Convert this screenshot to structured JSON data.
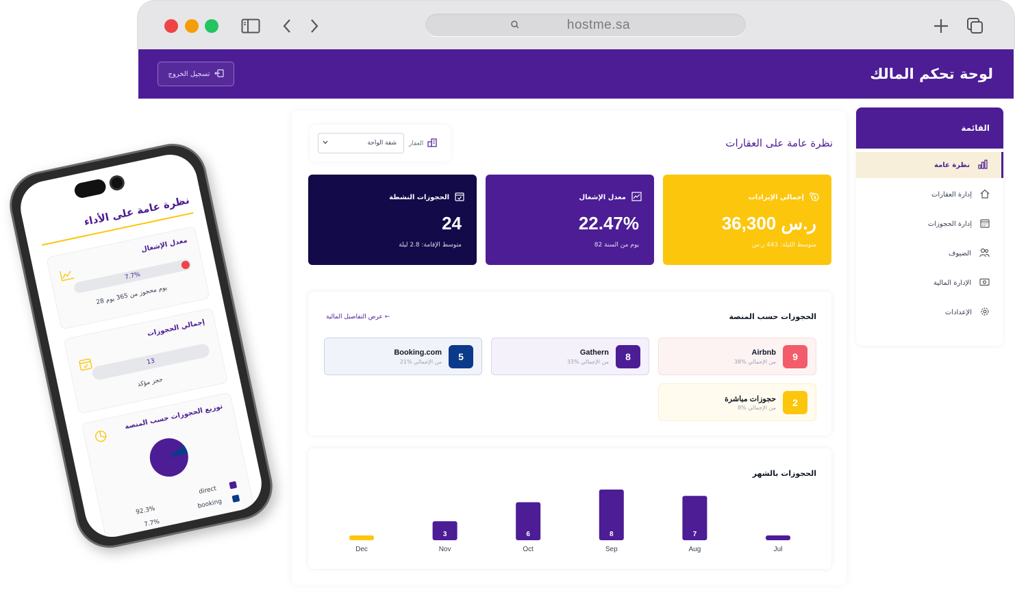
{
  "browser": {
    "url": "hostme.sa"
  },
  "app": {
    "title": "لوحة تحكم المالك",
    "logout_label": "تسجيل الخروج"
  },
  "sidebar": {
    "title": "القائمة",
    "items": [
      {
        "label": "نظرة عامة",
        "icon": "bar-chart-icon",
        "active": true
      },
      {
        "label": "إدارة العقارات",
        "icon": "home-icon"
      },
      {
        "label": "إدارة الحجوزات",
        "icon": "calendar-icon"
      },
      {
        "label": "الضيوف",
        "icon": "users-icon"
      },
      {
        "label": "الإدارة المالية",
        "icon": "cash-icon"
      },
      {
        "label": "الإعدادات",
        "icon": "gear-icon"
      }
    ]
  },
  "overview": {
    "title": "نظرة عامة على العقارات",
    "property_label": "العقار",
    "property_value": "شقة الواحة"
  },
  "stats": {
    "revenue": {
      "label": "إجمالي الإيرادات",
      "value": "36,300 ر.س",
      "sub": "متوسط الليلة: 443 ر.س"
    },
    "occupancy": {
      "label": "معدل الإشغال",
      "value": "22.47%",
      "sub": "82 يوم من السنة"
    },
    "active": {
      "label": "الحجوزات النشطة",
      "value": "24",
      "sub": "متوسط الإقامة: 2.8 ليلة"
    }
  },
  "platforms": {
    "title": "الحجوزات حسب المنصة",
    "link": "عرض التفاصيل المالية ←",
    "items": [
      {
        "name": "Airbnb",
        "count": "9",
        "pct": "38% من الإجمالي"
      },
      {
        "name": "Gathern",
        "count": "8",
        "pct": "33% من الإجمالي"
      },
      {
        "name": "Booking.com",
        "count": "5",
        "pct": "21% من الإجمالي"
      },
      {
        "name": "حجوزات مباشرة",
        "count": "2",
        "pct": "8% من الإجمالي"
      }
    ],
    "colors": {
      "airbnb": "#f25c6b",
      "gathern": "#4c1d95",
      "booking": "#0b3a8a",
      "direct": "#fcc60d"
    }
  },
  "monthly": {
    "title": "الحجوزات بالشهر"
  },
  "chart_data": {
    "type": "bar",
    "categories": [
      "Dec",
      "Nov",
      "Oct",
      "Sep",
      "Aug",
      "Jul"
    ],
    "values": [
      0,
      3,
      6,
      8,
      7,
      0
    ],
    "colors": {
      "bar": "#4c1d95",
      "zero_bar": "#fcc60d"
    }
  },
  "phone": {
    "title": "نظرة عامة على الأداء",
    "occupancy": {
      "title": "معدل الإشغال",
      "value": "7.7%",
      "sub": "28 يوم محجوز من 365 يوم"
    },
    "bookings": {
      "title": "إجمالي الحجوزات",
      "value": "13",
      "sub": "حجز مؤكد"
    },
    "distribution": {
      "title": "توزيع الحجوزات حسب المنصة",
      "legend": [
        {
          "label": "direct",
          "pct": "92.3%",
          "color": "#4c1d95"
        },
        {
          "label": "booking",
          "pct": "7.7%",
          "color": "#0b3a8a"
        }
      ]
    }
  }
}
